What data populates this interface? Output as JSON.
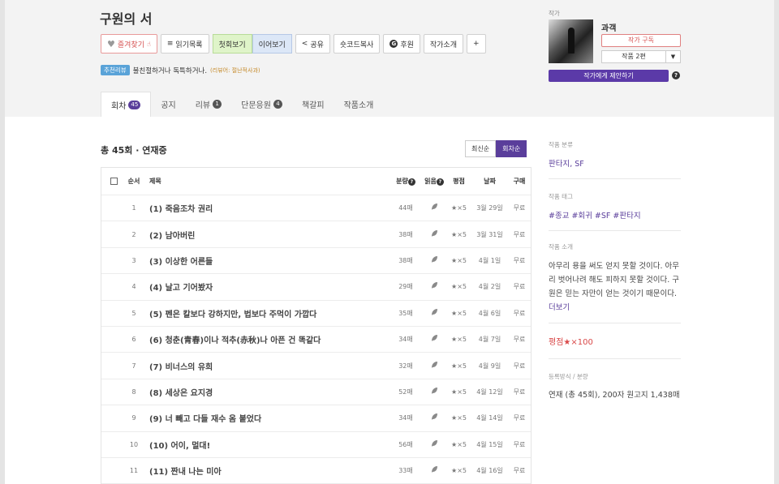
{
  "work": {
    "title": "구원의 서"
  },
  "buttons": {
    "favorite": "즐겨찾기",
    "reading_list": "읽기목록",
    "first_view": "첫회보기",
    "continue_view": "이어보기",
    "share": "공유",
    "shortcode": "숏코드복사",
    "sponsor": "후원",
    "author_intro": "작가소개",
    "more": "+"
  },
  "recommend": {
    "badge": "추천리뷰",
    "text": "불친절하거나 독특하거나.",
    "by": "(리뷰어: 절난적사과)"
  },
  "tabs": [
    {
      "label": "회차",
      "count": "45",
      "active": true
    },
    {
      "label": "공지",
      "count": "",
      "active": false
    },
    {
      "label": "리뷰",
      "count": "1",
      "active": false
    },
    {
      "label": "단문응원",
      "count": "4",
      "active": false
    },
    {
      "label": "책갈피",
      "count": "",
      "active": false
    },
    {
      "label": "작품소개",
      "count": "",
      "active": false
    }
  ],
  "author": {
    "label": "작가",
    "name": "과객",
    "subscribe": "작가 구독",
    "works": "작품 2편",
    "propose": "작가에게 제안하기",
    "help": "?"
  },
  "list": {
    "heading": "총 45회 · 연재중",
    "sort_latest": "최신순",
    "sort_episode": "회차순",
    "columns": {
      "no": "순서",
      "title": "제목",
      "volume": "분량",
      "read": "읽음",
      "rating": "평점",
      "date": "날짜",
      "buy": "구매"
    },
    "help": "?",
    "read_icon": "leaf-icon",
    "episodes": [
      {
        "no": "1",
        "title": "(1) 죽음조차 권리",
        "volume": "44매",
        "rating": "★×5",
        "date": "3월 29일",
        "buy": "무료"
      },
      {
        "no": "2",
        "title": "(2) 남아버린",
        "volume": "38매",
        "rating": "★×5",
        "date": "3월 31일",
        "buy": "무료"
      },
      {
        "no": "3",
        "title": "(3) 이상한 어른들",
        "volume": "38매",
        "rating": "★×5",
        "date": "4월 1일",
        "buy": "무료"
      },
      {
        "no": "4",
        "title": "(4) 날고 기어봤자",
        "volume": "29매",
        "rating": "★×5",
        "date": "4월 2일",
        "buy": "무료"
      },
      {
        "no": "5",
        "title": "(5) 펜은 칼보다 강하지만, 법보다 주먹이 가깝다",
        "volume": "35매",
        "rating": "★×5",
        "date": "4월 6일",
        "buy": "무료"
      },
      {
        "no": "6",
        "title": "(6) 청춘(青春)이나 적추(赤秋)나 아픈 건 똑같다",
        "volume": "34매",
        "rating": "★×5",
        "date": "4월 7일",
        "buy": "무료"
      },
      {
        "no": "7",
        "title": "(7) 비너스의 유희",
        "volume": "32매",
        "rating": "★×5",
        "date": "4월 9일",
        "buy": "무료"
      },
      {
        "no": "8",
        "title": "(8) 세상은 요지경",
        "volume": "52매",
        "rating": "★×5",
        "date": "4월 12일",
        "buy": "무료"
      },
      {
        "no": "9",
        "title": "(9) 너 빼고 다들 재수 옴 붙었다",
        "volume": "34매",
        "rating": "★×5",
        "date": "4월 14일",
        "buy": "무료"
      },
      {
        "no": "10",
        "title": "(10) 어이, 멀대!",
        "volume": "56매",
        "rating": "★×5",
        "date": "4월 15일",
        "buy": "무료"
      },
      {
        "no": "11",
        "title": "(11) 짠내 나는 미아",
        "volume": "33매",
        "rating": "★×5",
        "date": "4월 16일",
        "buy": "무료"
      }
    ]
  },
  "sidebar": {
    "genre_label": "작품 분류",
    "genre_value": "판타지, SF",
    "tags_label": "작품 태그",
    "tags_value": "#종교 #회귀 #SF #판타지",
    "intro_label": "작품 소개",
    "intro_text": "아무리 용을 써도 얻지 못할 것이다. 아무리 벗어나려 해도 피하지 못할 것이다. 구원은 믿는 자만이 얻는 것이기 때문이다.",
    "intro_more": "더보기",
    "rating": "평점★×100",
    "publish_label": "등록방식 / 분량",
    "publish_value": "연재 (총 45회), 200자 원고지 1,438매"
  },
  "colors": {
    "accent": "#5a3e9b",
    "favorite": "#d65050",
    "first_view_bg": "#dff4c9",
    "continue_view_bg": "#dce7f7",
    "rating": "#d94848"
  }
}
